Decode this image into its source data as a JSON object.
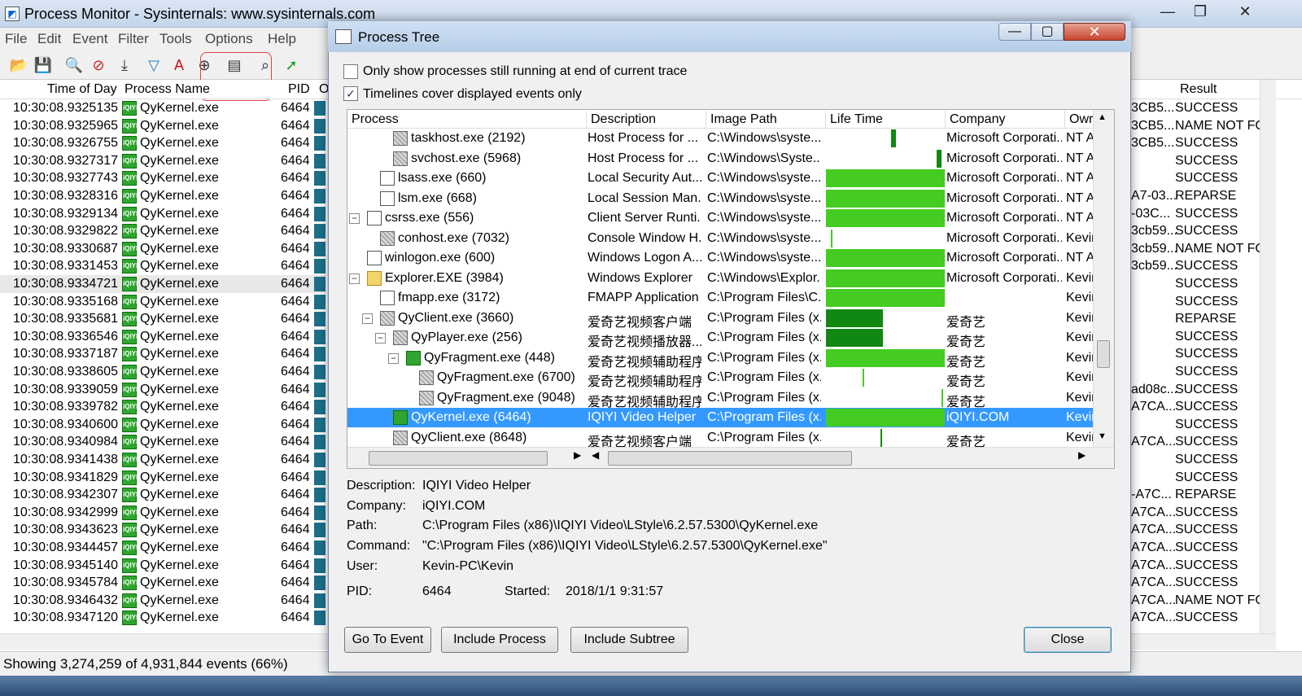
{
  "window": {
    "title": "Process Monitor - Sysinternals: www.sysinternals.com",
    "min": "—",
    "max": "❐",
    "close": "✕"
  },
  "menu": [
    "File",
    "Edit",
    "Event",
    "Filter",
    "Tools",
    "Options",
    "Help"
  ],
  "toolbar_icons": [
    "open-icon",
    "save-icon",
    "magnify-icon",
    "capture-icon",
    "autoscroll-icon",
    "filter-icon",
    "highlight-icon",
    "target-icon",
    "process-tree-icon",
    "find-icon",
    "jump-icon"
  ],
  "columns": {
    "time": "Time of Day",
    "process": "Process Name",
    "pid": "PID",
    "op": "O",
    "result": "Result"
  },
  "rows": [
    {
      "time": "10:30:08.9325135",
      "proc": "QyKernel.exe",
      "pid": "6464",
      "detail": "3CB5...",
      "result": "SUCCESS"
    },
    {
      "time": "10:30:08.9325965",
      "proc": "QyKernel.exe",
      "pid": "6464",
      "detail": "3CB5...",
      "result": "NAME NOT FO"
    },
    {
      "time": "10:30:08.9326755",
      "proc": "QyKernel.exe",
      "pid": "6464",
      "detail": "3CB5...",
      "result": "SUCCESS"
    },
    {
      "time": "10:30:08.9327317",
      "proc": "QyKernel.exe",
      "pid": "6464",
      "detail": "",
      "result": "SUCCESS"
    },
    {
      "time": "10:30:08.9327743",
      "proc": "QyKernel.exe",
      "pid": "6464",
      "detail": "",
      "result": "SUCCESS"
    },
    {
      "time": "10:30:08.9328316",
      "proc": "QyKernel.exe",
      "pid": "6464",
      "detail": "A7-03...",
      "result": "REPARSE"
    },
    {
      "time": "10:30:08.9329134",
      "proc": "QyKernel.exe",
      "pid": "6464",
      "detail": "-03C...",
      "result": "SUCCESS"
    },
    {
      "time": "10:30:08.9329822",
      "proc": "QyKernel.exe",
      "pid": "6464",
      "detail": "3cb59...",
      "result": "SUCCESS"
    },
    {
      "time": "10:30:08.9330687",
      "proc": "QyKernel.exe",
      "pid": "6464",
      "detail": "3cb59...",
      "result": "NAME NOT FO"
    },
    {
      "time": "10:30:08.9331453",
      "proc": "QyKernel.exe",
      "pid": "6464",
      "detail": "3cb59...",
      "result": "SUCCESS"
    },
    {
      "time": "10:30:08.9334721",
      "proc": "QyKernel.exe",
      "pid": "6464",
      "detail": "",
      "result": "SUCCESS"
    },
    {
      "time": "10:30:08.9335168",
      "proc": "QyKernel.exe",
      "pid": "6464",
      "detail": "",
      "result": "SUCCESS"
    },
    {
      "time": "10:30:08.9335681",
      "proc": "QyKernel.exe",
      "pid": "6464",
      "detail": "",
      "result": "REPARSE"
    },
    {
      "time": "10:30:08.9336546",
      "proc": "QyKernel.exe",
      "pid": "6464",
      "detail": "",
      "result": "SUCCESS"
    },
    {
      "time": "10:30:08.9337187",
      "proc": "QyKernel.exe",
      "pid": "6464",
      "detail": "",
      "result": "SUCCESS"
    },
    {
      "time": "10:30:08.9338605",
      "proc": "QyKernel.exe",
      "pid": "6464",
      "detail": "",
      "result": "SUCCESS"
    },
    {
      "time": "10:30:08.9339059",
      "proc": "QyKernel.exe",
      "pid": "6464",
      "detail": "ad08c...",
      "result": "SUCCESS"
    },
    {
      "time": "10:30:08.9339782",
      "proc": "QyKernel.exe",
      "pid": "6464",
      "detail": "A7CA...",
      "result": "SUCCESS"
    },
    {
      "time": "10:30:08.9340600",
      "proc": "QyKernel.exe",
      "pid": "6464",
      "detail": "",
      "result": "SUCCESS"
    },
    {
      "time": "10:30:08.9340984",
      "proc": "QyKernel.exe",
      "pid": "6464",
      "detail": "A7CA...",
      "result": "SUCCESS"
    },
    {
      "time": "10:30:08.9341438",
      "proc": "QyKernel.exe",
      "pid": "6464",
      "detail": "",
      "result": "SUCCESS"
    },
    {
      "time": "10:30:08.9341829",
      "proc": "QyKernel.exe",
      "pid": "6464",
      "detail": "",
      "result": "SUCCESS"
    },
    {
      "time": "10:30:08.9342307",
      "proc": "QyKernel.exe",
      "pid": "6464",
      "detail": "-A7C...",
      "result": "REPARSE"
    },
    {
      "time": "10:30:08.9342999",
      "proc": "QyKernel.exe",
      "pid": "6464",
      "detail": "A7CA...",
      "result": "SUCCESS"
    },
    {
      "time": "10:30:08.9343623",
      "proc": "QyKernel.exe",
      "pid": "6464",
      "detail": "A7CA...",
      "result": "SUCCESS"
    },
    {
      "time": "10:30:08.9344457",
      "proc": "QyKernel.exe",
      "pid": "6464",
      "detail": "A7CA...",
      "result": "SUCCESS"
    },
    {
      "time": "10:30:08.9345140",
      "proc": "QyKernel.exe",
      "pid": "6464",
      "detail": "A7CA...",
      "result": "SUCCESS"
    },
    {
      "time": "10:30:08.9345784",
      "proc": "QyKernel.exe",
      "pid": "6464",
      "detail": "A7CA...",
      "result": "SUCCESS"
    },
    {
      "time": "10:30:08.9346432",
      "proc": "QyKernel.exe",
      "pid": "6464",
      "detail": "A7CA...",
      "result": "NAME NOT FO"
    },
    {
      "time": "10:30:08.9347120",
      "proc": "QyKernel.exe",
      "pid": "6464",
      "detail": "A7CA...",
      "result": "SUCCESS"
    }
  ],
  "status": "Showing 3,274,259 of 4,931,844 events (66%)",
  "dialog": {
    "title": "Process Tree",
    "min": "—",
    "max": "▢",
    "close": "✕",
    "check1": "Only show processes still running at end of current trace",
    "check2": "Timelines cover displayed events only",
    "check2_mark": "✓",
    "columns": {
      "process": "Process",
      "description": "Description",
      "image": "Image Path",
      "life": "Life Time",
      "company": "Company",
      "owner": "Owr"
    },
    "tree": [
      {
        "name": "taskhost.exe (2192)",
        "desc": "Host Process for ...",
        "path": "C:\\Windows\\syste...",
        "company": "Microsoft Corporati...",
        "owner": "NT A",
        "indent": 3,
        "icon": "gray",
        "exp": "",
        "bar_start": 0.55,
        "bar_len": 0.04,
        "bar_dark": true
      },
      {
        "name": "svchost.exe (5968)",
        "desc": "Host Process for ...",
        "path": "C:\\Windows\\Syste...",
        "company": "Microsoft Corporati...",
        "owner": "NT A",
        "indent": 3,
        "icon": "gray",
        "exp": "",
        "bar_start": 0.93,
        "bar_len": 0.04,
        "bar_dark": true
      },
      {
        "name": "lsass.exe (660)",
        "desc": "Local Security Aut...",
        "path": "C:\\Windows\\syste...",
        "company": "Microsoft Corporati...",
        "owner": "NT A",
        "indent": 2,
        "icon": "win",
        "exp": "",
        "bar_start": 0,
        "bar_len": 1,
        "bar_dark": false
      },
      {
        "name": "lsm.exe (668)",
        "desc": "Local Session Man...",
        "path": "C:\\Windows\\syste...",
        "company": "Microsoft Corporati...",
        "owner": "NT A",
        "indent": 2,
        "icon": "win",
        "exp": "",
        "bar_start": 0,
        "bar_len": 1,
        "bar_dark": false
      },
      {
        "name": "csrss.exe (556)",
        "desc": "Client Server Runti...",
        "path": "C:\\Windows\\syste...",
        "company": "Microsoft Corporati...",
        "owner": "NT A",
        "indent": 1,
        "icon": "win",
        "exp": "−",
        "bar_start": 0,
        "bar_len": 1,
        "bar_dark": false
      },
      {
        "name": "conhost.exe (7032)",
        "desc": "Console Window H...",
        "path": "C:\\Windows\\syste...",
        "company": "Microsoft Corporati...",
        "owner": "Kevir",
        "indent": 2,
        "icon": "gray",
        "exp": "",
        "bar_start": 0.04,
        "bar_len": 0.01,
        "bar_dark": false
      },
      {
        "name": "winlogon.exe (600)",
        "desc": "Windows Logon A...",
        "path": "C:\\Windows\\syste...",
        "company": "Microsoft Corporati...",
        "owner": "NT A",
        "indent": 1,
        "icon": "win",
        "exp": "",
        "bar_start": 0,
        "bar_len": 1,
        "bar_dark": false
      },
      {
        "name": "Explorer.EXE (3984)",
        "desc": "Windows Explorer",
        "path": "C:\\Windows\\Explor...",
        "company": "Microsoft Corporati...",
        "owner": "Kevir",
        "indent": 1,
        "icon": "folder",
        "exp": "−",
        "bar_start": 0,
        "bar_len": 1,
        "bar_dark": false
      },
      {
        "name": "fmapp.exe (3172)",
        "desc": "FMAPP Application",
        "path": "C:\\Program Files\\C...",
        "company": "",
        "owner": "Kevir",
        "indent": 2,
        "icon": "win",
        "exp": "",
        "bar_start": 0,
        "bar_len": 1,
        "bar_dark": false
      },
      {
        "name": "QyClient.exe (3660)",
        "desc": "爱奇艺视频客户端",
        "path": "C:\\Program Files (x...",
        "company": "爱奇艺",
        "owner": "Kevir",
        "indent": 2,
        "icon": "gray",
        "exp": "−",
        "bar_start": 0,
        "bar_len": 0.48,
        "bar_dark": true
      },
      {
        "name": "QyPlayer.exe (256)",
        "desc": "爱奇艺视频播放器...",
        "path": "C:\\Program Files (x...",
        "company": "爱奇艺",
        "owner": "Kevir",
        "indent": 3,
        "icon": "gray",
        "exp": "−",
        "bar_start": 0,
        "bar_len": 0.48,
        "bar_dark": true
      },
      {
        "name": "QyFragment.exe (448)",
        "desc": "爱奇艺视频辅助程序",
        "path": "C:\\Program Files (x...",
        "company": "爱奇艺",
        "owner": "Kevir",
        "indent": 4,
        "icon": "green",
        "exp": "−",
        "bar_start": 0,
        "bar_len": 1,
        "bar_dark": false
      },
      {
        "name": "QyFragment.exe (6700)",
        "desc": "爱奇艺视频辅助程序",
        "path": "C:\\Program Files (x...",
        "company": "爱奇艺",
        "owner": "Kevir",
        "indent": 5,
        "icon": "gray",
        "exp": "",
        "bar_start": 0.31,
        "bar_len": 0.01,
        "bar_dark": false
      },
      {
        "name": "QyFragment.exe (9048)",
        "desc": "爱奇艺视频辅助程序",
        "path": "C:\\Program Files (x...",
        "company": "爱奇艺",
        "owner": "Kevir",
        "indent": 5,
        "icon": "gray",
        "exp": "",
        "bar_start": 0.97,
        "bar_len": 0.01,
        "bar_dark": false
      },
      {
        "name": "QyKernel.exe (6464)",
        "desc": "IQIYI Video Helper",
        "path": "C:\\Program Files (x...",
        "company": "iQIYI.COM",
        "owner": "Kevir",
        "indent": 3,
        "icon": "green",
        "exp": "",
        "bar_start": 0,
        "bar_len": 1,
        "bar_dark": false,
        "selected": true
      },
      {
        "name": "QyClient.exe (8648)",
        "desc": "爱奇艺视频客户端",
        "path": "C:\\Program Files (x...",
        "company": "爱奇艺",
        "owner": "Kevir",
        "indent": 3,
        "icon": "gray",
        "exp": "",
        "bar_start": 0.46,
        "bar_len": 0.01,
        "bar_dark": true
      }
    ],
    "details": {
      "description_label": "Description:",
      "description": "IQIYI Video Helper",
      "company_label": "Company:",
      "company": "iQIYI.COM",
      "path_label": "Path:",
      "path": "C:\\Program Files (x86)\\IQIYI Video\\LStyle\\6.2.57.5300\\QyKernel.exe",
      "command_label": "Command:",
      "command": "\"C:\\Program Files (x86)\\IQIYI Video\\LStyle\\6.2.57.5300\\QyKernel.exe\"",
      "user_label": "User:",
      "user": "Kevin-PC\\Kevin",
      "pid_label": "PID:",
      "pid": "6464",
      "started_label": "Started:",
      "started": "2018/1/1 9:31:57"
    },
    "buttons": {
      "goto": "Go To Event",
      "include_process": "Include Process",
      "include_subtree": "Include Subtree",
      "close": "Close"
    }
  }
}
